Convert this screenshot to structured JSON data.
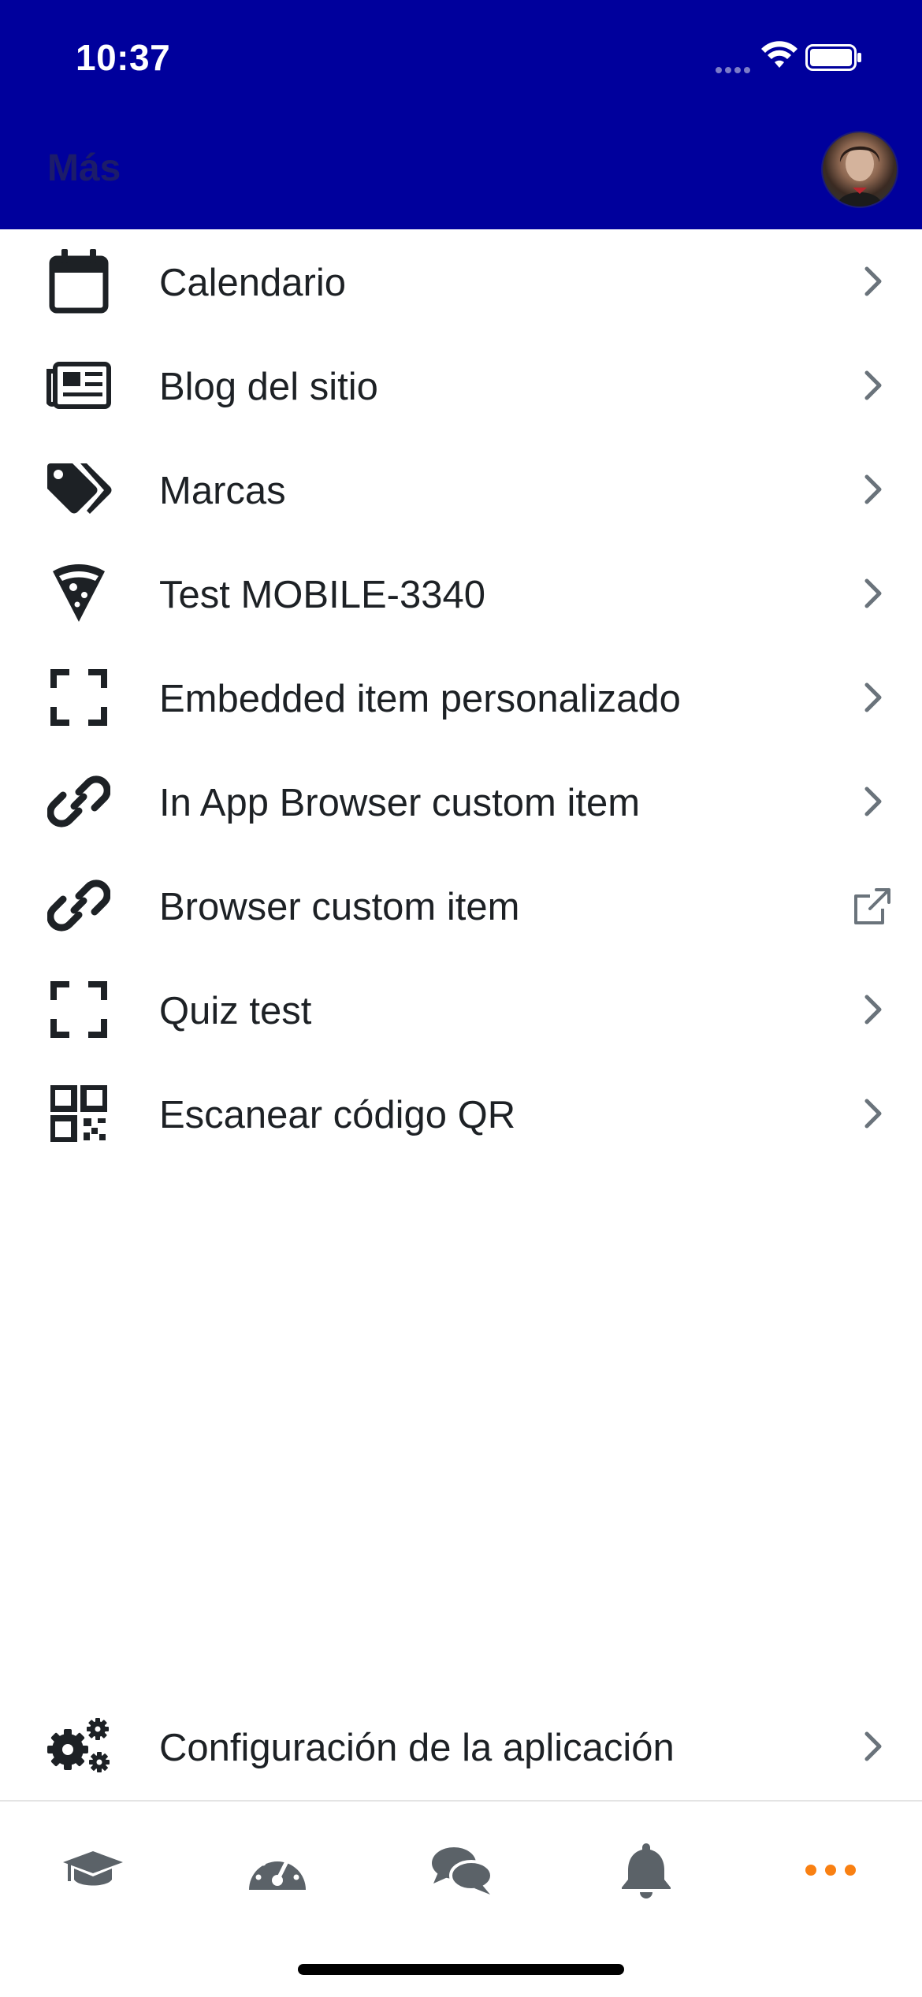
{
  "status_bar": {
    "time": "10:37"
  },
  "header": {
    "title": "Más"
  },
  "menu": {
    "items": [
      {
        "label": "Calendario",
        "icon": "calendar-icon",
        "action": "chevron-right-icon"
      },
      {
        "label": "Blog del sitio",
        "icon": "newspaper-icon",
        "action": "chevron-right-icon"
      },
      {
        "label": "Marcas",
        "icon": "tags-icon",
        "action": "chevron-right-icon"
      },
      {
        "label": "Test MOBILE-3340",
        "icon": "pizza-slice-icon",
        "action": "chevron-right-icon"
      },
      {
        "label": "Embedded item personalizado",
        "icon": "expand-icon",
        "action": "chevron-right-icon"
      },
      {
        "label": "In App Browser custom item",
        "icon": "link-icon",
        "action": "chevron-right-icon"
      },
      {
        "label": "Browser custom item",
        "icon": "link-icon",
        "action": "external-link-icon"
      },
      {
        "label": "Quiz test",
        "icon": "expand-icon",
        "action": "chevron-right-icon"
      },
      {
        "label": "Escanear código QR",
        "icon": "qrcode-icon",
        "action": "chevron-right-icon"
      }
    ],
    "settings": {
      "label": "Configuración de la aplicación",
      "icon": "cogs-icon"
    }
  },
  "tabbar": {
    "tabs": [
      "graduation-cap-icon",
      "dashboard-icon",
      "comments-icon",
      "bell-icon",
      "more-icon"
    ],
    "active": "more-icon"
  },
  "colors": {
    "header_bg": "#00009c",
    "active_tab": "#f98012",
    "icon": "#1d2125",
    "chevron": "#6a737b"
  }
}
